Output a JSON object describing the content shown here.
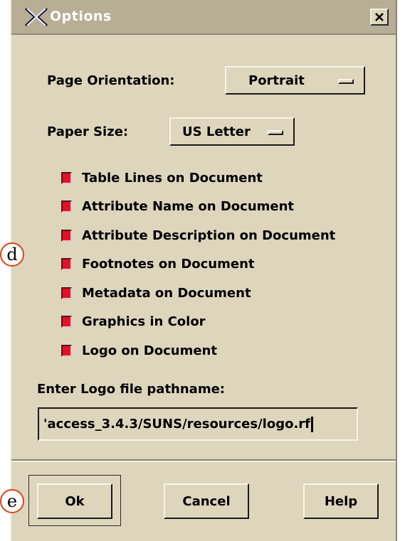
{
  "window": {
    "title": "Options"
  },
  "page_orientation": {
    "label": "Page Orientation:",
    "value": "Portrait"
  },
  "paper_size": {
    "label": "Paper Size:",
    "value": "US Letter"
  },
  "checkboxes": [
    {
      "label": "Table Lines on Document",
      "checked": true
    },
    {
      "label": "Attribute Name on Document",
      "checked": true
    },
    {
      "label": "Attribute Description on Document",
      "checked": true
    },
    {
      "label": "Footnotes on Document",
      "checked": true
    },
    {
      "label": "Metadata on Document",
      "checked": true
    },
    {
      "label": "Graphics in Color",
      "checked": true
    },
    {
      "label": "Logo on Document",
      "checked": true
    }
  ],
  "logo_path": {
    "label": "Enter Logo file pathname:",
    "value": "'access_3.4.3/SUNS/resources/logo.rf"
  },
  "buttons": {
    "ok": "Ok",
    "cancel": "Cancel",
    "help": "Help"
  },
  "callouts": {
    "d": "d",
    "e": "e"
  },
  "colors": {
    "background": "#ded5bd",
    "titlebar": "#b8ae96",
    "checkbox": "#e0112b",
    "callout_ring": "#d9441c"
  }
}
